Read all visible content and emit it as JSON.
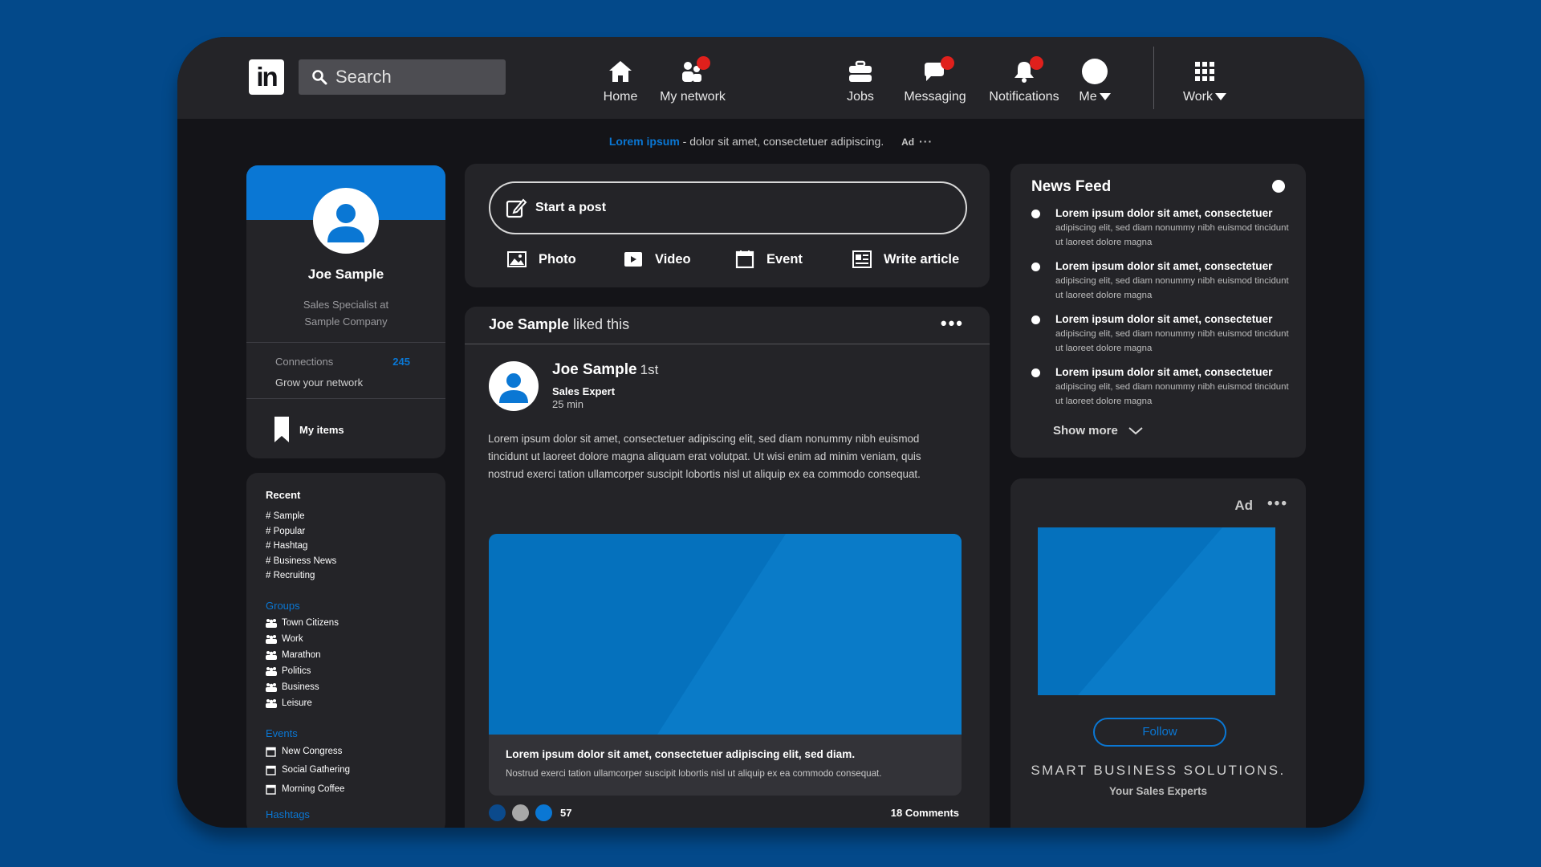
{
  "topbar": {
    "logo": "in",
    "search_placeholder": "Search",
    "nav": [
      {
        "label": "Home",
        "icon": "home-icon",
        "badge": false
      },
      {
        "label": "My network",
        "icon": "network-icon",
        "badge": true
      },
      {
        "label": "Jobs",
        "icon": "briefcase-icon",
        "badge": false
      },
      {
        "label": "Messaging",
        "icon": "messaging-icon",
        "badge": true
      },
      {
        "label": "Notifications",
        "icon": "bell-icon",
        "badge": true
      },
      {
        "label": "Me",
        "icon": "avatar-icon",
        "badge": false
      },
      {
        "label": "Work",
        "icon": "grid-icon",
        "badge": false
      }
    ]
  },
  "ad_line": {
    "link": "Lorem ipsum",
    "text": " - dolor sit amet, consectetuer adipiscing.",
    "ad": "Ad",
    "more": "···"
  },
  "profile": {
    "name": "Joe Sample",
    "title_line1": "Sales Specialist at",
    "title_line2": "Sample Company",
    "connections_label": "Connections",
    "connections_count": "245",
    "grow": "Grow your network",
    "my_items": "My items"
  },
  "left_list": {
    "recent_title": "Recent",
    "recent": [
      "# Sample",
      "# Popular",
      "# Hashtag",
      "# Business News",
      "# Recruiting"
    ],
    "groups_title": "Groups",
    "groups": [
      "Town Citizens",
      "Work",
      "Marathon",
      "Politics",
      "Business",
      "Leisure"
    ],
    "events_title": "Events",
    "events": [
      "New Congress",
      "Social Gathering",
      "Morning Coffee"
    ],
    "hashtags_title": "Hashtags"
  },
  "composer": {
    "start": "Start a post",
    "actions": [
      "Photo",
      "Video",
      "Event",
      "Write article"
    ]
  },
  "post": {
    "liker": "Joe Sample",
    "liked_text": " liked this",
    "author": "Joe Sample",
    "degree": "1st",
    "role": "Sales Expert",
    "time": "25 min",
    "body": "Lorem ipsum dolor sit amet, consectetuer adipiscing elit, sed diam nonummy nibh euismod tincidunt ut laoreet dolore magna aliquam erat volutpat. Ut wisi enim ad minim veniam, quis nostrud exerci tation ullamcorper suscipit lobortis nisl ut aliquip ex ea commodo consequat.",
    "media_title": "Lorem ipsum dolor sit amet, consectetuer adipiscing elit, sed diam.",
    "media_desc": "Nostrud exerci tation ullamcorper suscipit lobortis nisl ut aliquip ex ea commodo consequat.",
    "reactions_count": "57",
    "comments": "18 Comments",
    "reaction_colors": [
      "#0b4a8c",
      "#a8a8a8",
      "#0a77d4"
    ]
  },
  "news": {
    "title": "News Feed",
    "items": [
      {
        "title": "Lorem ipsum dolor sit amet, consectetuer",
        "desc": "adipiscing elit, sed diam nonummy nibh euismod tincidunt ut laoreet dolore magna"
      },
      {
        "title": "Lorem ipsum dolor sit amet, consectetuer",
        "desc": "adipiscing elit, sed diam nonummy nibh euismod tincidunt ut laoreet dolore magna"
      },
      {
        "title": "Lorem ipsum dolor sit amet, consectetuer",
        "desc": "adipiscing elit, sed diam nonummy nibh euismod tincidunt ut laoreet dolore magna"
      },
      {
        "title": "Lorem ipsum dolor sit amet, consectetuer",
        "desc": "adipiscing elit, sed diam nonummy nibh euismod tincidunt ut laoreet dolore magna"
      }
    ],
    "show_more": "Show more"
  },
  "ad_card": {
    "ad": "Ad",
    "more": "•••",
    "follow": "Follow",
    "brand": "SMART BUSINESS SOLUTIONS.",
    "tagline": "Your Sales Experts"
  },
  "colors": {
    "accent": "#0a77d4",
    "background": "#03498a",
    "panel": "#242428",
    "badge": "#e0201c"
  }
}
